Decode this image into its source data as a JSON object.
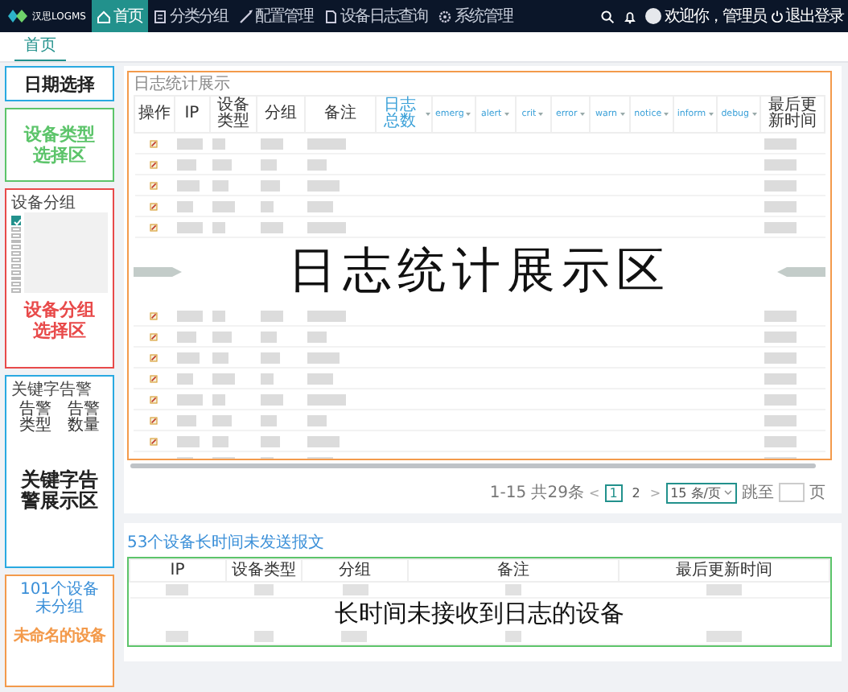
{
  "header": {
    "logo": "汉思LOGMS",
    "nav": [
      {
        "label": "首页",
        "selected": true
      },
      {
        "label": "分类分组",
        "selected": false
      },
      {
        "label": "配置管理",
        "selected": false
      },
      {
        "label": "设备日志查询",
        "selected": false
      },
      {
        "label": "系统管理",
        "selected": false
      }
    ],
    "welcome": "欢迎你，管理员",
    "logout": "退出登录"
  },
  "tabs": [
    {
      "label": "首页",
      "selected": true
    }
  ],
  "sidebar": {
    "panels": [
      {
        "kind": "date",
        "color": "#29a9e1",
        "annotation": "日期选择"
      },
      {
        "kind": "type",
        "color": "#5cc46a",
        "annotation": "设备类型选择区"
      },
      {
        "kind": "group",
        "color": "#e84a4a",
        "title": "设备分组",
        "annotation": "设备分组选择区",
        "checkboxes": [
          {
            "checked": true
          },
          {
            "checked": false
          },
          {
            "checked": false
          },
          {
            "checked": false
          },
          {
            "checked": false
          },
          {
            "checked": false
          },
          {
            "checked": false
          },
          {
            "checked": false
          },
          {
            "checked": false
          },
          {
            "checked": false
          },
          {
            "checked": false
          },
          {
            "checked": false
          }
        ]
      },
      {
        "kind": "keyword",
        "color": "#29a9e1",
        "title": "关键字告警",
        "columns": [
          "告警类型",
          "告警数量"
        ],
        "annotation": "关键字告警展示区"
      },
      {
        "kind": "ungrouped",
        "color": "#f39a4b",
        "link": "101个设备未分组",
        "annotation": "未命名的设备"
      }
    ]
  },
  "log_stats": {
    "title": "日志统计展示",
    "annotation": "日志统计展示区",
    "columns": [
      {
        "label": "操作",
        "sortable": false
      },
      {
        "label": "IP",
        "sortable": false
      },
      {
        "label": "设备类型",
        "sortable": false
      },
      {
        "label": "分组",
        "sortable": false
      },
      {
        "label": "备注",
        "sortable": false
      },
      {
        "label": "日志总数",
        "sortable": true
      },
      {
        "label": "emerg",
        "sortable": true
      },
      {
        "label": "alert",
        "sortable": true
      },
      {
        "label": "crit",
        "sortable": true
      },
      {
        "label": "error",
        "sortable": true
      },
      {
        "label": "warn",
        "sortable": true
      },
      {
        "label": "notice",
        "sortable": true
      },
      {
        "label": "inform",
        "sortable": true
      },
      {
        "label": "debug",
        "sortable": true
      },
      {
        "label": "最后更新时间",
        "sortable": false
      }
    ],
    "rows_above": [
      {
        "selected": false
      },
      {
        "selected": false
      },
      {
        "selected": false
      },
      {
        "selected": false
      },
      {
        "selected": false
      }
    ],
    "rows_below": [
      {
        "selected": false
      },
      {
        "selected": false
      },
      {
        "selected": false
      },
      {
        "selected": false
      },
      {
        "selected": false
      },
      {
        "selected": false
      },
      {
        "selected": false
      },
      {
        "selected": false
      }
    ],
    "pagination": {
      "summary": "1-15 共29条",
      "prev": "<",
      "pages": [
        {
          "label": "1",
          "selected": true
        },
        {
          "label": "2",
          "selected": false
        }
      ],
      "next": ">",
      "page_size": "15 条/页",
      "jump_label": "跳至",
      "jump_suffix": "页"
    }
  },
  "stale_devices": {
    "title": "53个设备长时间未发送报文",
    "annotation": "长时间未接收到日志的设备",
    "columns": [
      "IP",
      "设备类型",
      "分组",
      "备注",
      "最后更新时间"
    ]
  }
}
